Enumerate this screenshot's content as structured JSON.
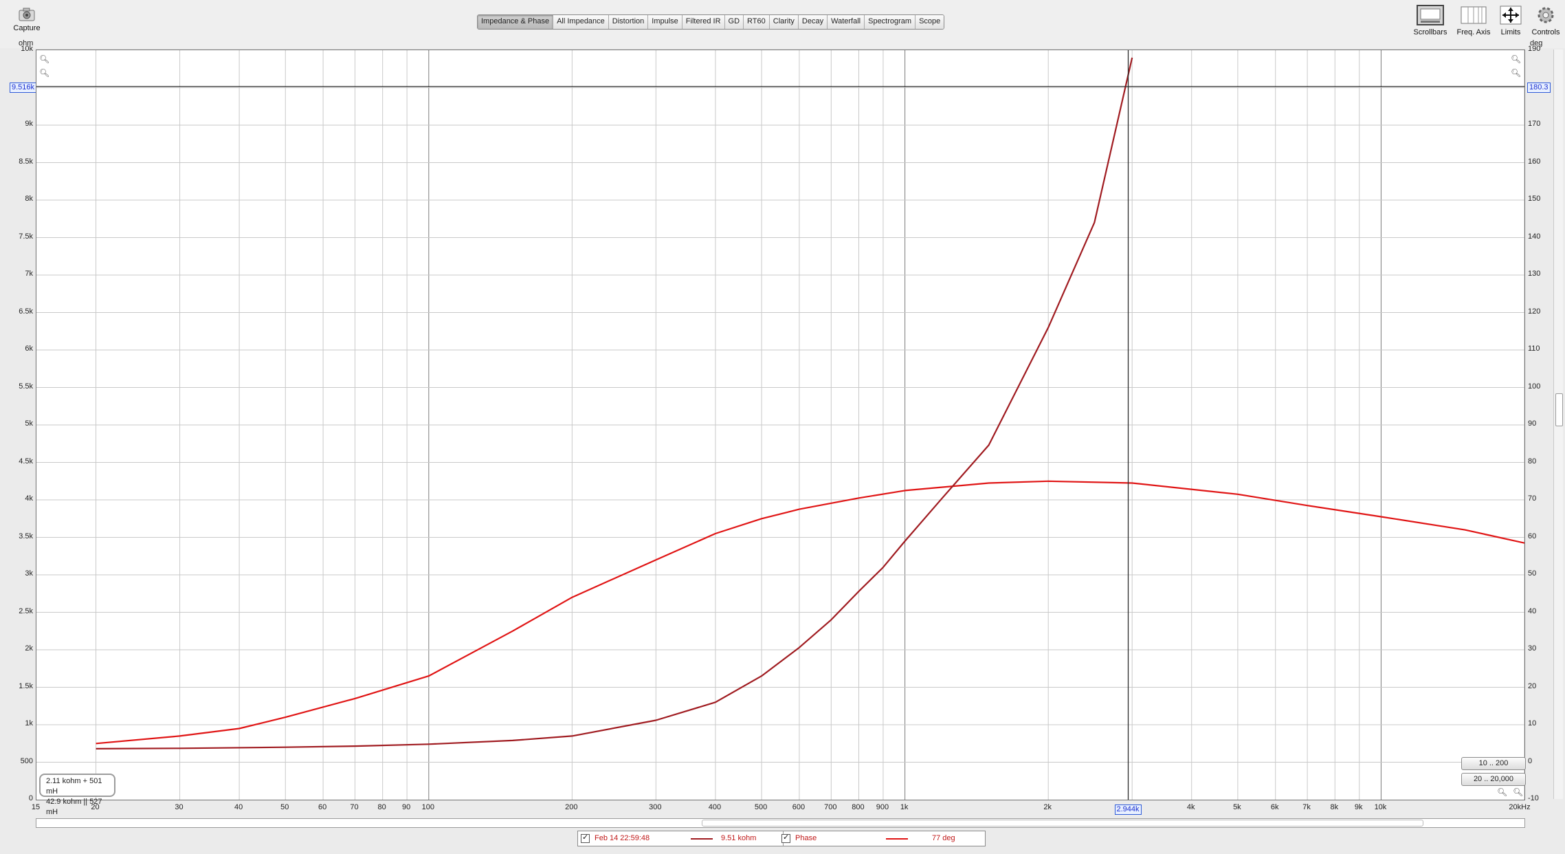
{
  "toolbar": {
    "capture_label": "Capture",
    "tabs": [
      "Impedance & Phase",
      "All Impedance",
      "Distortion",
      "Impulse",
      "Filtered IR",
      "GD",
      "RT60",
      "Clarity",
      "Decay",
      "Waterfall",
      "Spectrogram",
      "Scope"
    ],
    "active_tab": "Impedance & Phase",
    "scrollbars_label": "Scrollbars",
    "freq_axis_label": "Freq. Axis",
    "limits_label": "Limits",
    "controls_label": "Controls"
  },
  "axes": {
    "left_unit": "ohm",
    "right_unit": "deg",
    "left_ticks": [
      "10k",
      "9k",
      "8.5k",
      "8k",
      "7.5k",
      "7k",
      "6.5k",
      "6k",
      "5.5k",
      "5k",
      "4.5k",
      "4k",
      "3.5k",
      "3k",
      "2.5k",
      "2k",
      "1.5k",
      "1k",
      "500",
      "0"
    ],
    "right_ticks": [
      "190",
      "170",
      "160",
      "150",
      "140",
      "130",
      "120",
      "110",
      "100",
      "90",
      "80",
      "70",
      "60",
      "50",
      "40",
      "30",
      "20",
      "10",
      "0",
      "-10"
    ],
    "x_ticks": [
      "15",
      "20",
      "30",
      "40",
      "50",
      "60",
      "70",
      "80",
      "90",
      "100",
      "200",
      "300",
      "400",
      "500",
      "600",
      "700",
      "800",
      "900",
      "1k",
      "2k",
      "4k",
      "5k",
      "6k",
      "7k",
      "8k",
      "9k",
      "10k",
      "20kHz"
    ]
  },
  "cursor": {
    "left_readout": "9.516k",
    "right_readout": "180.3",
    "x_readout": "2.944k"
  },
  "range_buttons": [
    "10 .. 200",
    "20 .. 20,000"
  ],
  "info_box": {
    "line1": "2.11 kohm + 501 mH",
    "line2": "42.9 kohm || 527 mH"
  },
  "legend": {
    "trace_name": "Feb 14 22:59:48",
    "impedance_value": "9.51 kohm",
    "phase_label": "Phase",
    "phase_value": "77 deg"
  },
  "colors": {
    "impedance": "#a01b20",
    "phase": "#e01414",
    "grid": "#c9c9c9",
    "grid_major": "#7a7a7a",
    "cursor": "#2b2b2b"
  },
  "chart_data": {
    "type": "line",
    "x_scale": "log",
    "xlim": [
      15,
      20000
    ],
    "ylim_left": [
      0,
      10000
    ],
    "ylim_right": [
      -10,
      190
    ],
    "grid": true,
    "series": [
      {
        "name": "Impedance",
        "axis": "left",
        "x": [
          20,
          30,
          50,
          70,
          100,
          150,
          200,
          300,
          400,
          500,
          600,
          700,
          800,
          900,
          1000,
          1200,
          1500,
          2000,
          2500,
          3000
        ],
        "y": [
          680,
          685,
          700,
          715,
          740,
          790,
          850,
          1060,
          1300,
          1650,
          2030,
          2400,
          2780,
          3100,
          3450,
          4030,
          4730,
          6300,
          7700,
          9900
        ]
      },
      {
        "name": "Phase",
        "axis": "right",
        "x": [
          20,
          30,
          40,
          50,
          70,
          100,
          150,
          200,
          300,
          400,
          500,
          600,
          800,
          1000,
          1500,
          2000,
          3000,
          5000,
          7000,
          10000,
          15000,
          20000
        ],
        "y": [
          5,
          7,
          9,
          12,
          17,
          23,
          35,
          44,
          54,
          61,
          65,
          67.5,
          70.5,
          72.5,
          74.5,
          75,
          74.5,
          71.5,
          68.5,
          65.5,
          62,
          58.5
        ]
      }
    ]
  }
}
